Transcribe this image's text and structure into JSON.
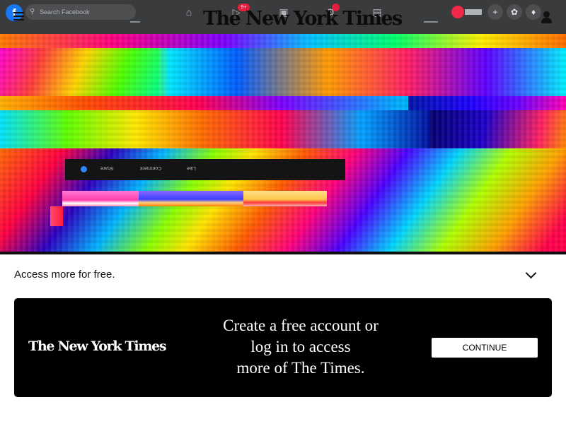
{
  "header": {
    "search_placeholder": "Search Facebook",
    "fb_logo_letter": "f",
    "masthead": "The New York Times",
    "nav_icons": [
      "home-icon",
      "watch-icon",
      "marketplace-icon",
      "groups-icon",
      "gaming-icon"
    ],
    "right_icons": [
      "plus-icon",
      "messenger-icon",
      "notifications-icon",
      "account-icon"
    ],
    "badge_watch": "9+",
    "badge_groups": ""
  },
  "glitch": {
    "actions": {
      "like": "Like",
      "comment": "Comment",
      "share": "Share"
    }
  },
  "paywall": {
    "access_text": "Access more for free.",
    "promo_logo": "The New York Times",
    "promo_line1": "Create a free account or",
    "promo_line2": "log in to access",
    "promo_line3": "more of The Times.",
    "continue_label": "CONTINUE"
  },
  "colors": {
    "header_bg": "#3a3b3c",
    "facebook_blue": "#1877f2",
    "badge_red": "#e41e3f",
    "card_bg": "#000000",
    "button_bg": "#ffffff"
  }
}
